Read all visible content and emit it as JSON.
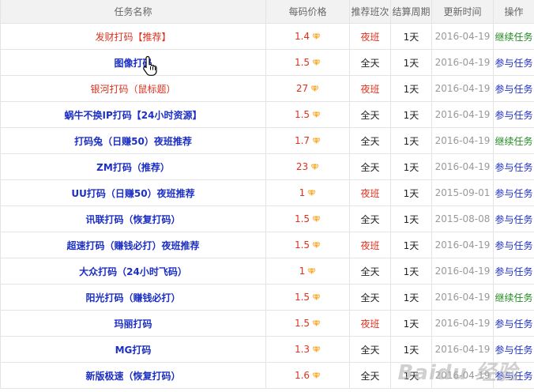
{
  "headers": {
    "name": "任务名称",
    "price": "每码价格",
    "shift": "推荐班次",
    "cycle": "结算周期",
    "updated": "更新时间",
    "action": "操作"
  },
  "rows": [
    {
      "name": "发财打码【推荐】",
      "name_color": "red",
      "price": "1.4",
      "shift": "夜班",
      "cycle": "1天",
      "date": "2016-04-19",
      "action": "继续任务",
      "action_color": "green"
    },
    {
      "name": "图像打码",
      "name_color": "blue",
      "price": "1.5",
      "shift": "全天",
      "cycle": "1天",
      "date": "2016-04-19",
      "action": "参与任务",
      "action_color": "blue"
    },
    {
      "name": "银河打码（鼠标题）",
      "name_color": "red",
      "price": "27",
      "shift": "夜班",
      "cycle": "1天",
      "date": "2016-04-19",
      "action": "参与任务",
      "action_color": "blue"
    },
    {
      "name": "蜗牛不换IP打码【24小时资源】",
      "name_color": "blue",
      "price": "1.5",
      "shift": "全天",
      "cycle": "1天",
      "date": "2016-04-19",
      "action": "参与任务",
      "action_color": "blue"
    },
    {
      "name": "打码兔（日赚50）夜班推荐",
      "name_color": "blue",
      "price": "1.7",
      "shift": "全天",
      "cycle": "1天",
      "date": "2016-04-19",
      "action": "继续任务",
      "action_color": "green"
    },
    {
      "name": "ZM打码（推荐）",
      "name_color": "blue",
      "price": "23",
      "shift": "全天",
      "cycle": "1天",
      "date": "2016-04-19",
      "action": "参与任务",
      "action_color": "blue"
    },
    {
      "name": "UU打码（日赚50）夜班推荐",
      "name_color": "blue",
      "price": "1",
      "shift": "夜班",
      "cycle": "1天",
      "date": "2015-09-01",
      "action": "参与任务",
      "action_color": "blue"
    },
    {
      "name": "讯联打码（恢复打码）",
      "name_color": "blue",
      "price": "1.5",
      "shift": "全天",
      "cycle": "1天",
      "date": "2015-08-08",
      "action": "参与任务",
      "action_color": "blue"
    },
    {
      "name": "超速打码（赚钱必打）夜班推荐",
      "name_color": "blue",
      "price": "1.5",
      "shift": "夜班",
      "cycle": "1天",
      "date": "2016-04-19",
      "action": "参与任务",
      "action_color": "blue"
    },
    {
      "name": "大众打码（24小时飞码）",
      "name_color": "blue",
      "price": "1",
      "shift": "全天",
      "cycle": "1天",
      "date": "2016-04-19",
      "action": "参与任务",
      "action_color": "blue"
    },
    {
      "name": "阳光打码（赚钱必打）",
      "name_color": "blue",
      "price": "1.5",
      "shift": "全天",
      "cycle": "1天",
      "date": "2016-04-19",
      "action": "继续任务",
      "action_color": "green"
    },
    {
      "name": "玛丽打码",
      "name_color": "blue",
      "price": "1.5",
      "shift": "夜班",
      "cycle": "1天",
      "date": "2016-04-19",
      "action": "参与任务",
      "action_color": "blue"
    },
    {
      "name": "MG打码",
      "name_color": "blue",
      "price": "1.3",
      "shift": "全天",
      "cycle": "1天",
      "date": "2016-04-19",
      "action": "参与任务",
      "action_color": "blue"
    },
    {
      "name": "新版极速（恢复打码）",
      "name_color": "blue",
      "price": "1.6",
      "shift": "全天",
      "cycle": "1天",
      "date": "2016-04-19",
      "action": "参与任务",
      "action_color": "blue"
    }
  ],
  "icons": {
    "price_icon": "diamond-icon",
    "cursor": "hand-pointer-icon"
  },
  "colors": {
    "red": "#e0301e",
    "blue": "#1c2fc4",
    "green": "#1f8a1f",
    "diamond": "#f5a623"
  },
  "watermark": "Baidu 经验"
}
